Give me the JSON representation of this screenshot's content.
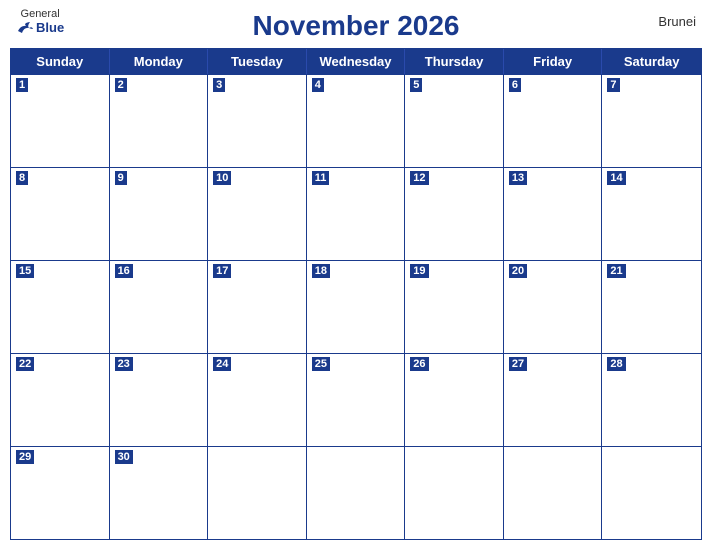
{
  "header": {
    "title": "November 2026",
    "country": "Brunei",
    "logo": {
      "general": "General",
      "blue": "Blue"
    }
  },
  "days_of_week": [
    "Sunday",
    "Monday",
    "Tuesday",
    "Wednesday",
    "Thursday",
    "Friday",
    "Saturday"
  ],
  "weeks": [
    [
      {
        "day": 1,
        "active": true
      },
      {
        "day": 2,
        "active": true
      },
      {
        "day": 3,
        "active": true
      },
      {
        "day": 4,
        "active": true
      },
      {
        "day": 5,
        "active": true
      },
      {
        "day": 6,
        "active": true
      },
      {
        "day": 7,
        "active": true
      }
    ],
    [
      {
        "day": 8,
        "active": true
      },
      {
        "day": 9,
        "active": true
      },
      {
        "day": 10,
        "active": true
      },
      {
        "day": 11,
        "active": true
      },
      {
        "day": 12,
        "active": true
      },
      {
        "day": 13,
        "active": true
      },
      {
        "day": 14,
        "active": true
      }
    ],
    [
      {
        "day": 15,
        "active": true
      },
      {
        "day": 16,
        "active": true
      },
      {
        "day": 17,
        "active": true
      },
      {
        "day": 18,
        "active": true
      },
      {
        "day": 19,
        "active": true
      },
      {
        "day": 20,
        "active": true
      },
      {
        "day": 21,
        "active": true
      }
    ],
    [
      {
        "day": 22,
        "active": true
      },
      {
        "day": 23,
        "active": true
      },
      {
        "day": 24,
        "active": true
      },
      {
        "day": 25,
        "active": true
      },
      {
        "day": 26,
        "active": true
      },
      {
        "day": 27,
        "active": true
      },
      {
        "day": 28,
        "active": true
      }
    ],
    [
      {
        "day": 29,
        "active": true
      },
      {
        "day": 30,
        "active": true
      },
      {
        "day": null,
        "active": false
      },
      {
        "day": null,
        "active": false
      },
      {
        "day": null,
        "active": false
      },
      {
        "day": null,
        "active": false
      },
      {
        "day": null,
        "active": false
      }
    ]
  ]
}
